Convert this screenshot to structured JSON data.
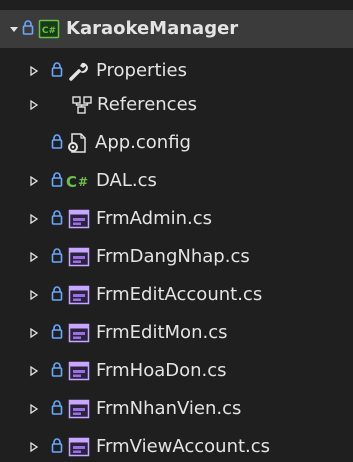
{
  "solution": {
    "project_name": "KaraokeManager",
    "project_icon": "csharp-project-icon",
    "items": [
      {
        "label": "Properties",
        "icon": "wrench-icon",
        "expandable": true,
        "locked": true
      },
      {
        "label": "References",
        "icon": "references-icon",
        "expandable": true,
        "locked": false
      },
      {
        "label": "App.config",
        "icon": "config-file-icon",
        "expandable": false,
        "locked": true
      },
      {
        "label": "DAL.cs",
        "icon": "csharp-file-icon",
        "expandable": true,
        "locked": true
      },
      {
        "label": "FrmAdmin.cs",
        "icon": "form-icon",
        "expandable": true,
        "locked": true
      },
      {
        "label": "FrmDangNhap.cs",
        "icon": "form-icon",
        "expandable": true,
        "locked": true
      },
      {
        "label": "FrmEditAccount.cs",
        "icon": "form-icon",
        "expandable": true,
        "locked": true
      },
      {
        "label": "FrmEditMon.cs",
        "icon": "form-icon",
        "expandable": true,
        "locked": true
      },
      {
        "label": "FrmHoaDon.cs",
        "icon": "form-icon",
        "expandable": true,
        "locked": true
      },
      {
        "label": "FrmNhanVien.cs",
        "icon": "form-icon",
        "expandable": true,
        "locked": true
      },
      {
        "label": "FrmViewAccount.cs",
        "icon": "form-icon",
        "expandable": true,
        "locked": true
      }
    ]
  },
  "colors": {
    "background": "#1f1f1f",
    "selected_row": "#3b3b3b",
    "text": "#e4e4e4",
    "lock": "#6aa8ff",
    "csharp": "#6cc04a",
    "form_purple": "#9b6fe0",
    "form_header": "#c9a6ff"
  }
}
